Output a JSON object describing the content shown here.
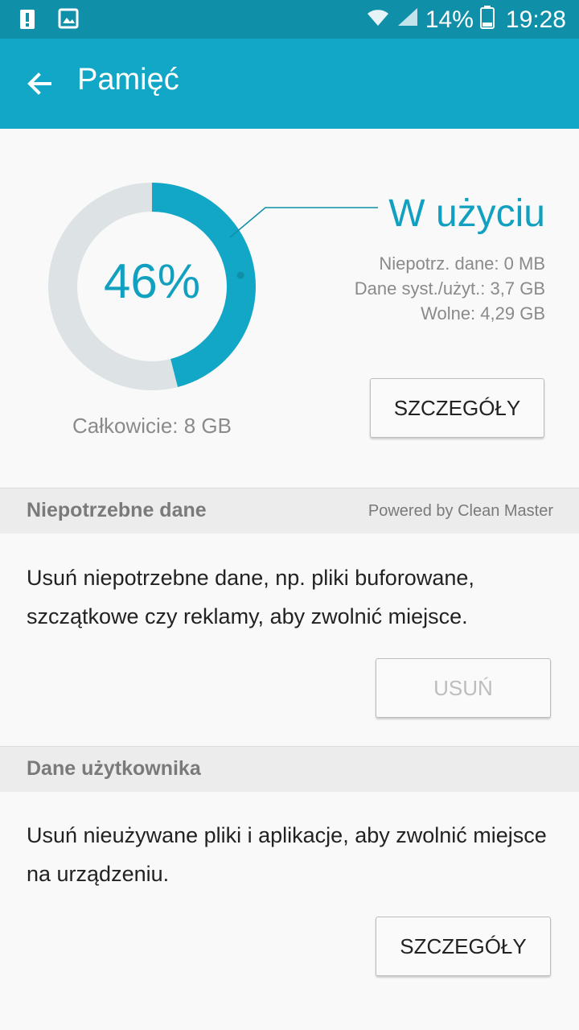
{
  "status_bar": {
    "battery_percent": "14%",
    "time": "19:28",
    "icons": [
      "alert-icon",
      "image-icon",
      "wifi-icon",
      "signal-icon",
      "battery-icon"
    ]
  },
  "app_bar": {
    "title": "Pamięć"
  },
  "storage": {
    "used_fraction": 0.46,
    "percent_label": "46%",
    "in_use_label": "W użyciu",
    "stats": [
      "Niepotrz. dane: 0 MB",
      "Dane syst./użyt.: 3,7 GB",
      "Wolne: 4,29 GB"
    ],
    "total_label": "Całkowicie: 8 GB",
    "details_button": "SZCZEGÓŁY"
  },
  "junk_section": {
    "header": "Niepotrzebne dane",
    "powered_by": "Powered by Clean Master",
    "description": "Usuń niepotrzebne dane, np. pliki buforowane, szczątkowe czy reklamy, aby zwolnić miejsce.",
    "delete_button": "USUŃ"
  },
  "user_data_section": {
    "header": "Dane użytkownika",
    "description": "Usuń nieużywane pliki i aplikacje, aby zwolnić miejsce na urządzeniu.",
    "details_button": "SZCZEGÓŁY"
  },
  "colors": {
    "accent": "#12a7c6",
    "status_bar": "#0f8fa8",
    "donut_track": "#dde2e4"
  }
}
